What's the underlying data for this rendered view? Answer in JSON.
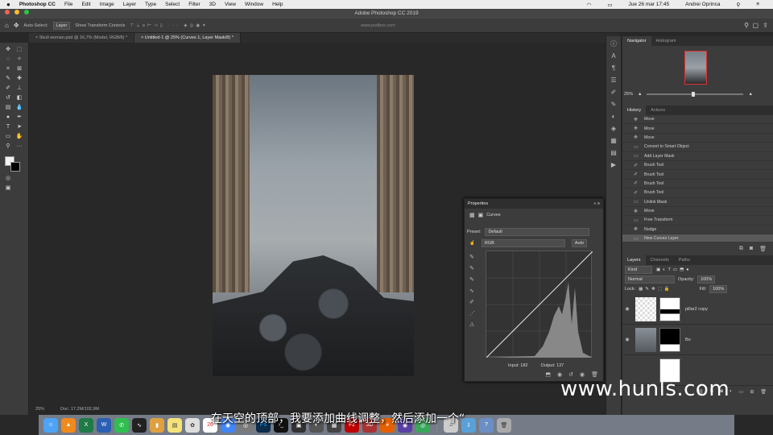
{
  "menubar": {
    "apple": "",
    "app": "Photoshop CC",
    "items": [
      "File",
      "Edit",
      "Image",
      "Layer",
      "Type",
      "Select",
      "Filter",
      "3D",
      "View",
      "Window",
      "Help"
    ],
    "datetime": "Jue 26 mar  17:45",
    "user": "Andrei Oprinca"
  },
  "window": {
    "title": "Adobe Photoshop CC 2019",
    "url": "www.psdbox.com"
  },
  "options": {
    "auto_select": "Auto-Select:",
    "layer": "Layer",
    "show_transform": "Show Transform Controls"
  },
  "tabs": [
    {
      "label": "Skull woman.psd @ 16,7% (Model, RGB/8) *"
    },
    {
      "label": "Untitled-1 @ 25% (Curves 1, Layer Mask/8) *"
    }
  ],
  "navigator": {
    "tabs": [
      "Navigator",
      "Histogram"
    ],
    "zoom": "25%"
  },
  "history": {
    "tabs": [
      "History",
      "Actions"
    ],
    "items": [
      "Move",
      "Move",
      "Move",
      "Convert to Smart Object",
      "Add Layer Mask",
      "Brush Tool",
      "Brush Tool",
      "Brush Tool",
      "Brush Tool",
      "Unlink Mask",
      "Move",
      "Free Transform",
      "Nudge",
      "New Curves Layer"
    ]
  },
  "layers": {
    "tabs": [
      "Layers",
      "Channels",
      "Paths"
    ],
    "kind": "Kind",
    "blend": "Normal",
    "opacity_label": "Opacity:",
    "opacity": "100%",
    "lock_label": "Lock:",
    "fill_label": "Fill:",
    "fill": "100%",
    "rows": [
      {
        "name": "pillar2 copy"
      },
      {
        "name": "Bo"
      },
      {
        "name": ""
      }
    ]
  },
  "properties": {
    "title": "Properties",
    "type": "Curves",
    "preset_label": "Preset:",
    "preset": "Default",
    "channel": "RGB",
    "auto": "Auto",
    "input_label": "Input:",
    "input": "182",
    "output_label": "Output:",
    "output": "137"
  },
  "status": {
    "zoom": "25%",
    "doc": "Doc: 17,2M/102,9M"
  },
  "watermark": "www.hunls.com",
  "subtitle": "在天空的顶部，我要添加曲线调整，然后添加一个“"
}
